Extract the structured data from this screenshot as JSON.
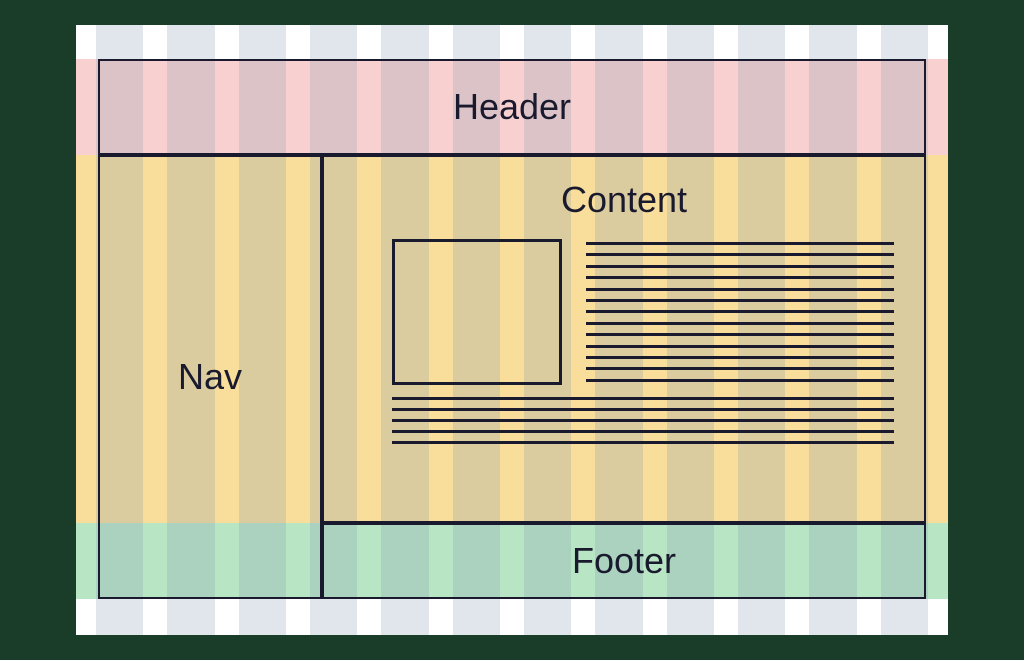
{
  "layout": {
    "header": {
      "label": "Header"
    },
    "nav": {
      "label": "Nav"
    },
    "content": {
      "label": "Content"
    },
    "footer": {
      "label": "Footer"
    }
  },
  "grid": {
    "columns": 12,
    "horizontal_bands": [
      "white",
      "red",
      "orange",
      "green",
      "white"
    ]
  },
  "content_placeholder": {
    "lines_right": 13,
    "lines_bottom": 5
  }
}
